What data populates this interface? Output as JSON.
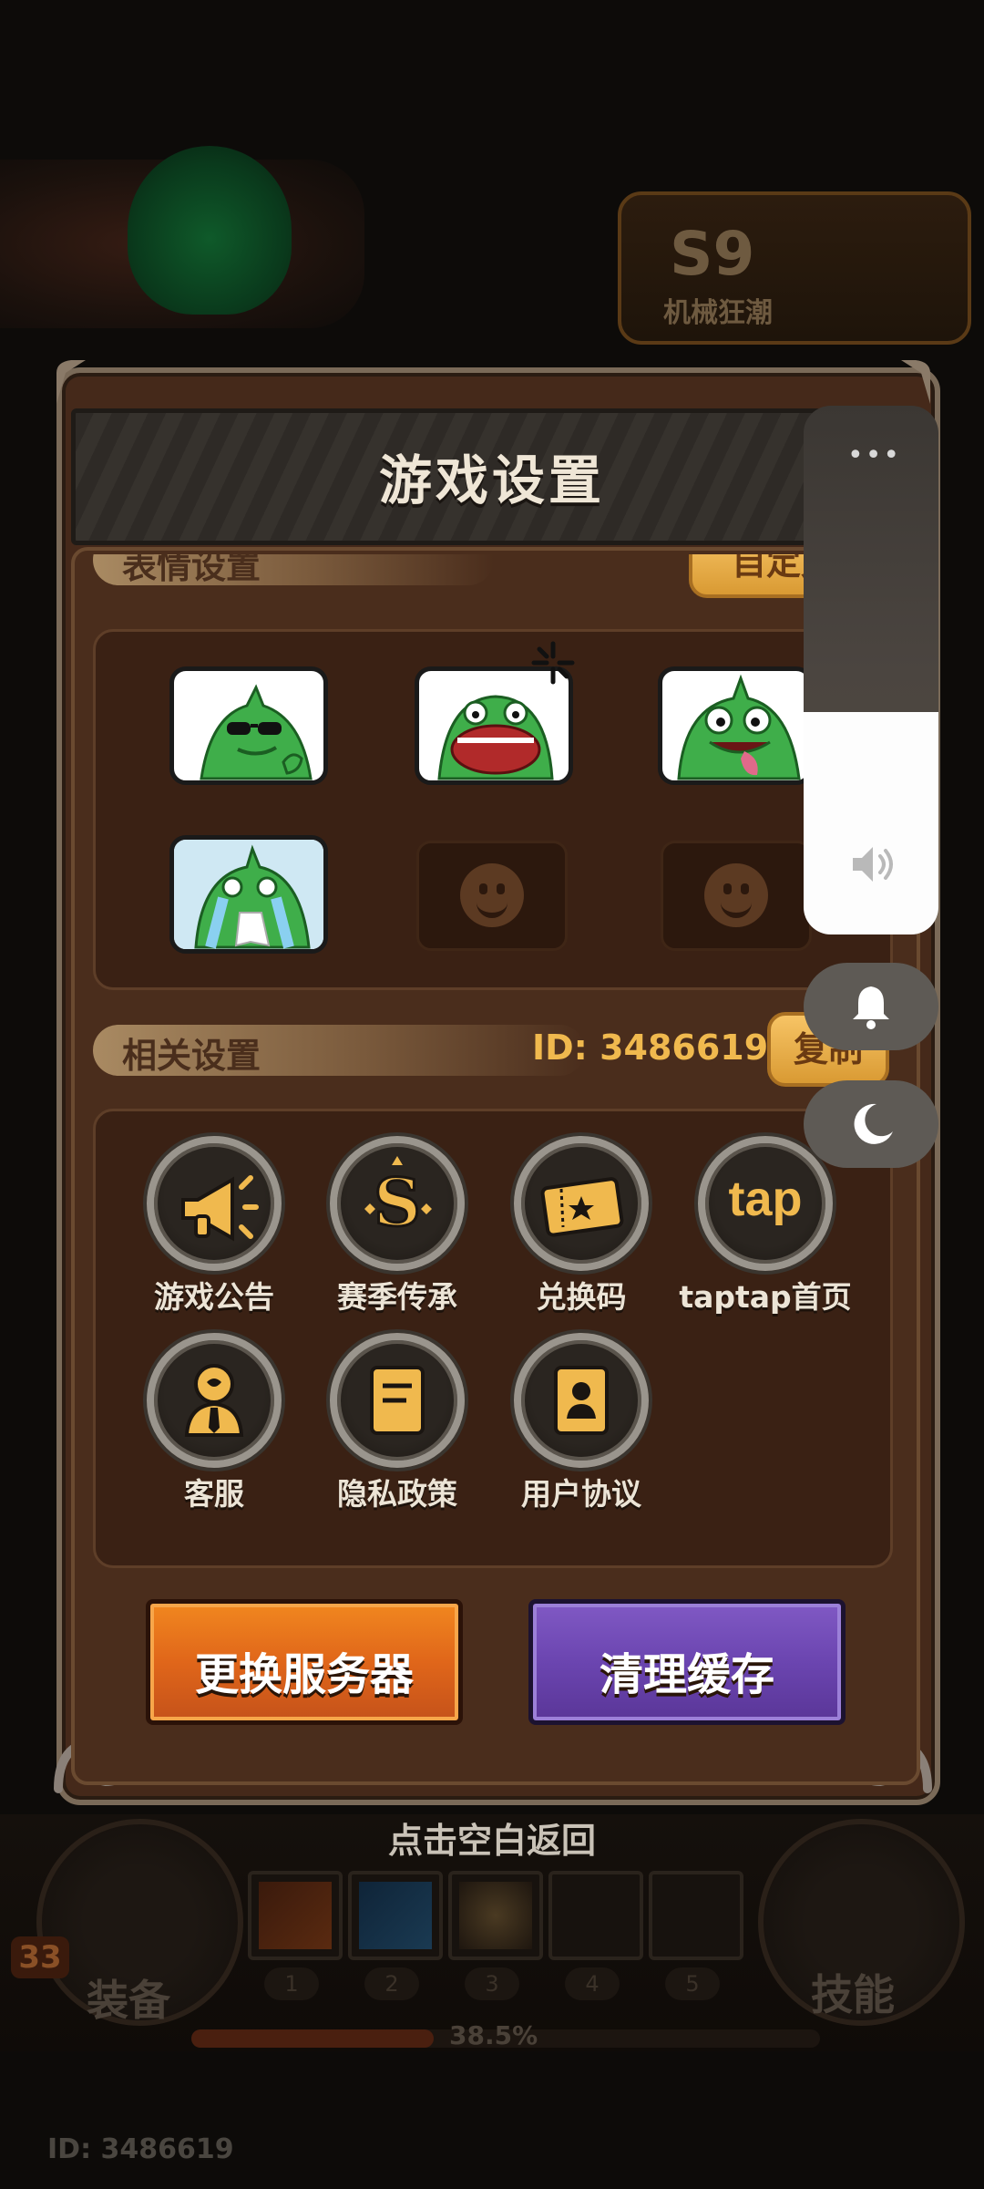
{
  "background": {
    "season_badge": {
      "title": "S9",
      "subtitle": "机械狂潮"
    },
    "level": "33",
    "equip_label": "装备",
    "skill_label": "技能",
    "slot_numbers": [
      "1",
      "2",
      "3",
      "4",
      "5"
    ],
    "progress_value": 0.385,
    "progress_text": "38.5%",
    "player_id": "ID: 3486619"
  },
  "dialog": {
    "title": "游戏设置",
    "emote_section": {
      "label": "表情设置",
      "custom_button": "自定义"
    },
    "related_section": {
      "label": "相关设置",
      "id_text": "ID: 3486619",
      "copy_button": "复制"
    },
    "settings_items": [
      {
        "label": "游戏公告",
        "icon": "megaphone-icon"
      },
      {
        "label": "赛季传承",
        "icon": "season-s-icon"
      },
      {
        "label": "兑换码",
        "icon": "ticket-icon"
      },
      {
        "label": "taptap首页",
        "icon": "taptap-icon",
        "icon_text": "tap"
      },
      {
        "label": "客服",
        "icon": "customer-service-icon"
      },
      {
        "label": "隐私政策",
        "icon": "document-icon"
      },
      {
        "label": "用户协议",
        "icon": "user-agreement-icon"
      }
    ],
    "change_server_button": "更换服务器",
    "clear_cache_button": "清理缓存"
  },
  "tap_blank_to_return": "点击空白返回",
  "system_volume": {
    "level": 0.42,
    "more_icon": "more-dots-icon",
    "speaker_icon": "speaker-icon",
    "bell_icon": "bell-icon",
    "moon_icon": "moon-icon"
  },
  "colors": {
    "dialog_brown": "#45291a",
    "gold": "#f0b94e",
    "orange_button": "#e0661a",
    "purple_button": "#6b45b0"
  }
}
